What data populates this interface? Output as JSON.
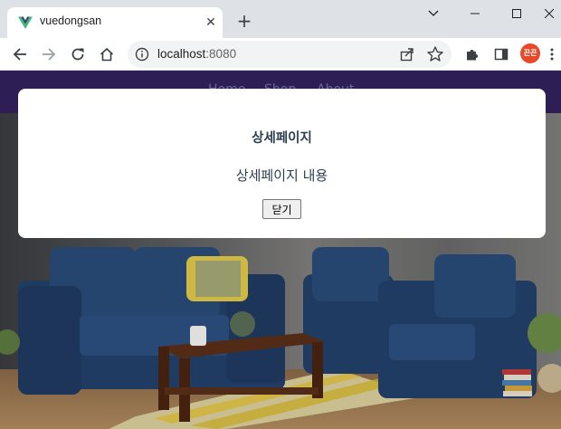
{
  "browser": {
    "tab_title": "vuedongsan",
    "new_tab_symbol": "+",
    "tab_close_symbol": "✕",
    "address_host": "localhost",
    "address_port": ":8080",
    "profile_label": "끈끈",
    "profile_color": "#e8492a"
  },
  "icons": {
    "favicon": "vue-logo-icon",
    "back": "back-arrow-icon",
    "forward": "forward-arrow-icon",
    "reload": "reload-icon",
    "home": "home-icon",
    "site_info": "info-icon",
    "share": "share-icon",
    "bookmark": "star-icon",
    "extensions": "puzzle-icon",
    "side_panel": "side-panel-icon",
    "menu": "kebab-menu-icon"
  },
  "navbar": {
    "background": "#2d1f55",
    "items": [
      "Home",
      "Shop",
      "About"
    ]
  },
  "modal": {
    "title": "상세페이지",
    "body": "상세페이지 내용",
    "close_label": "닫기"
  }
}
